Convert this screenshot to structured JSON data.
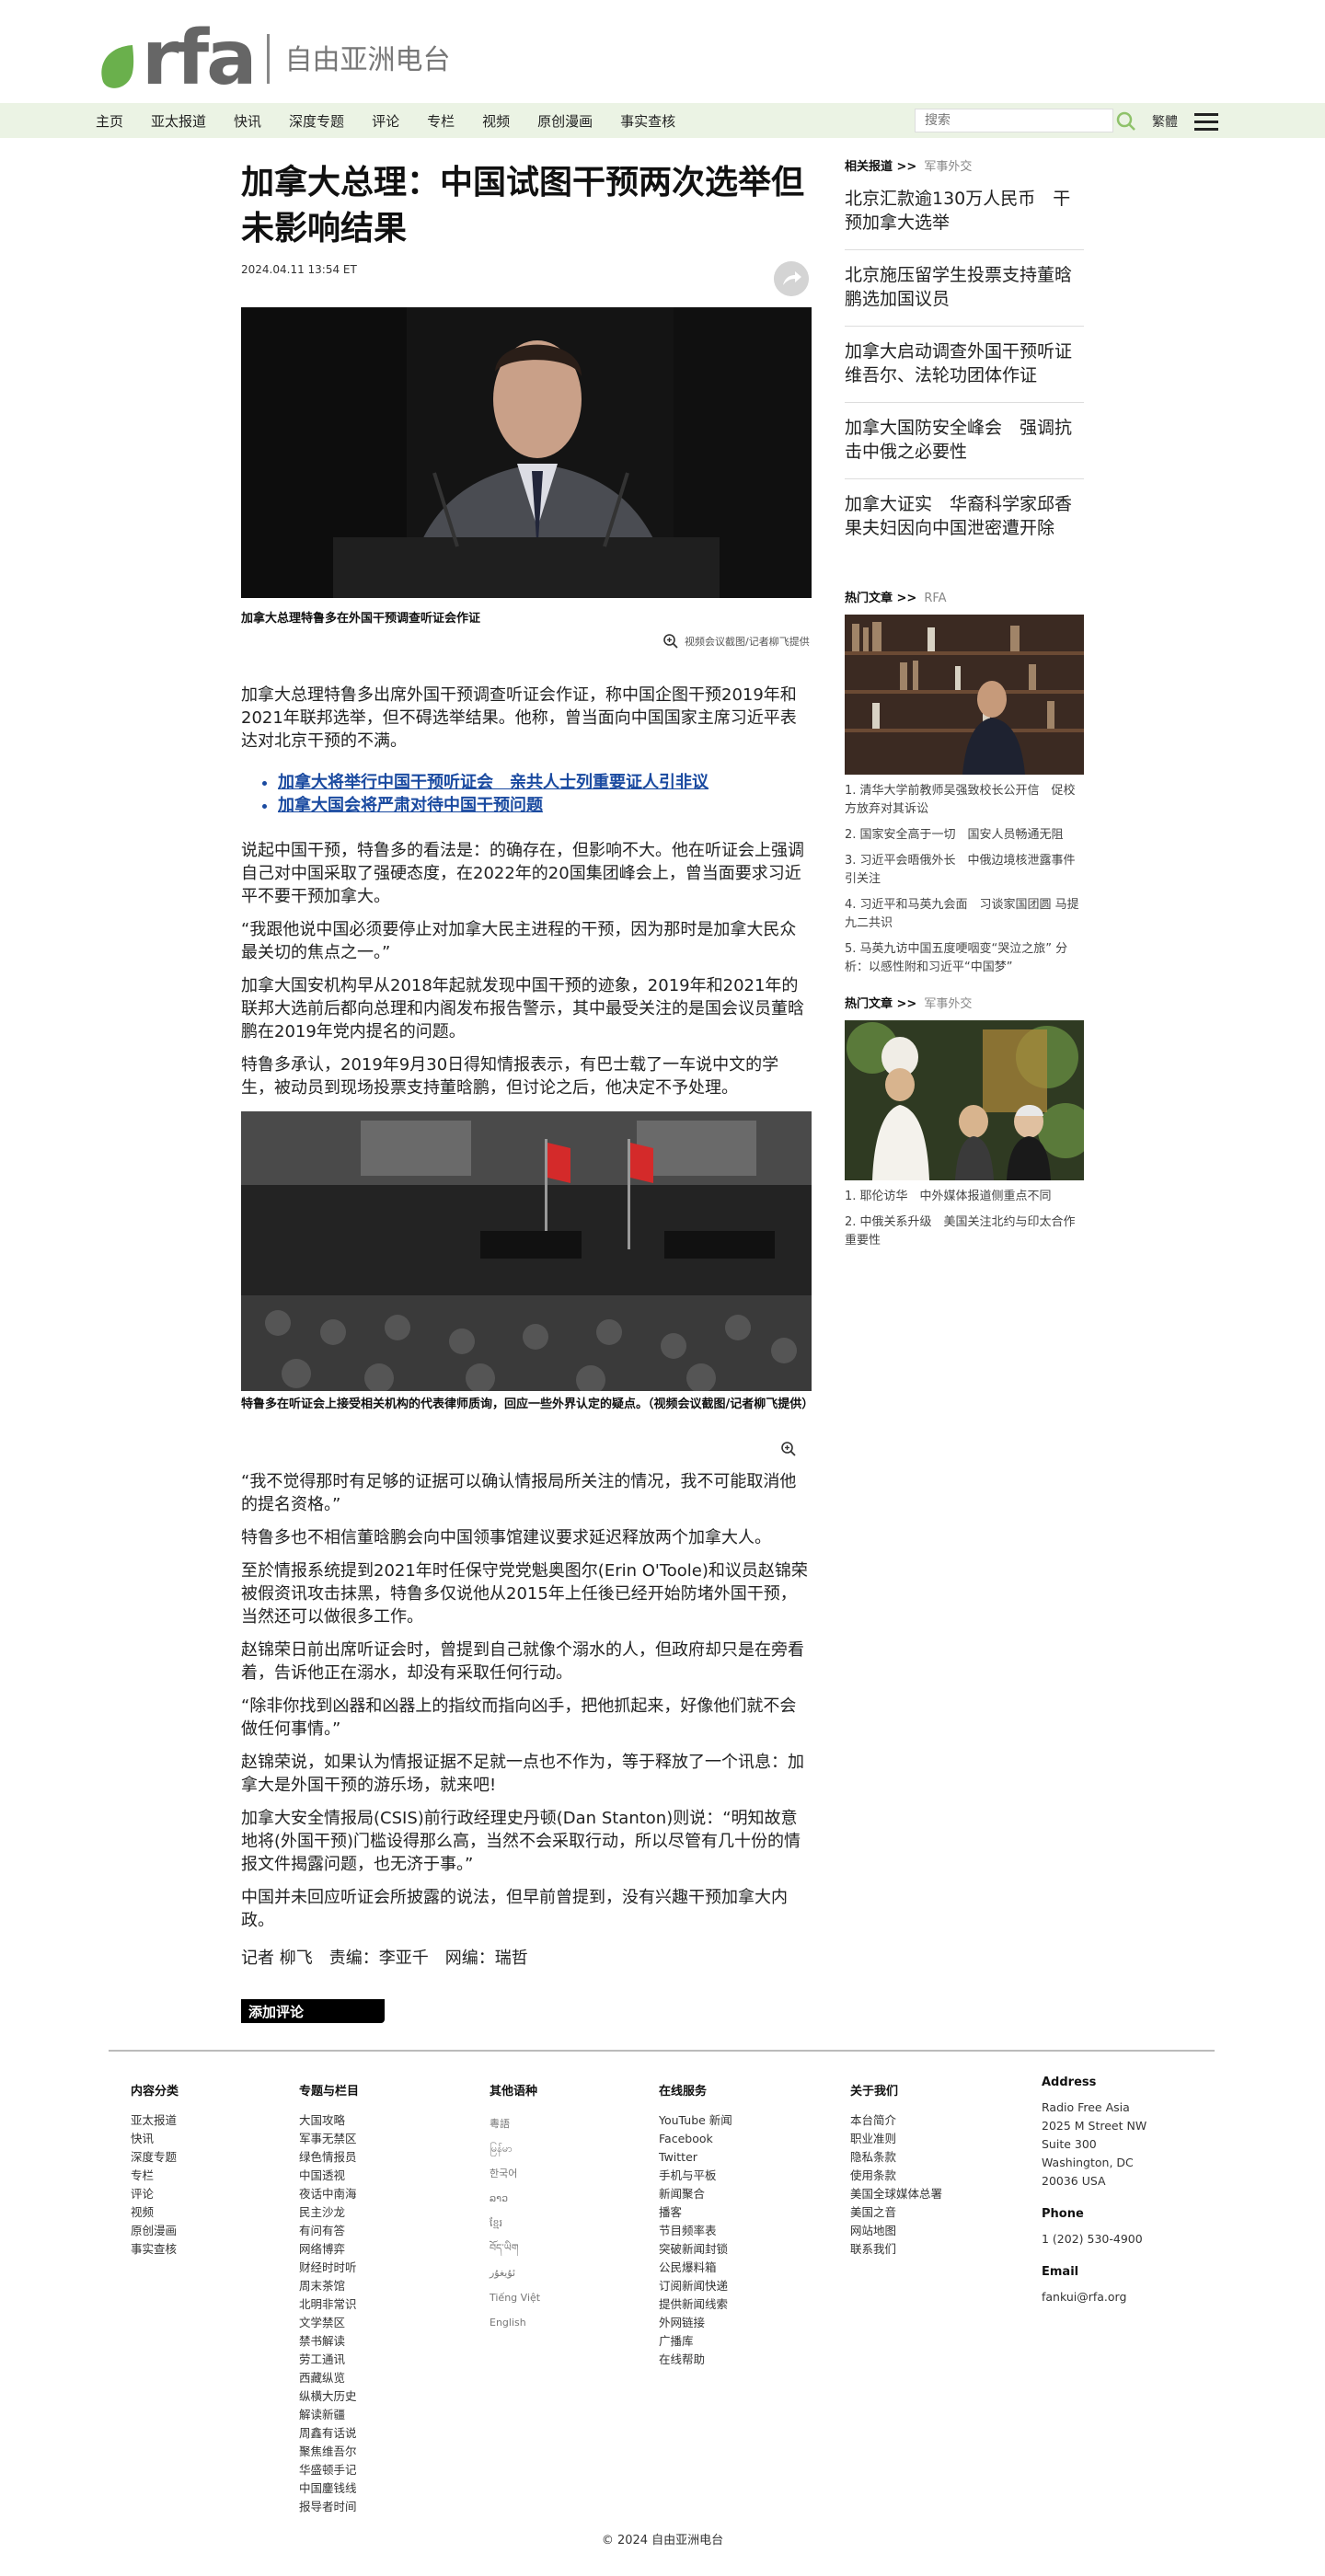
{
  "header": {
    "logo_text": "rfa",
    "logo_cn": "自由亚洲电台",
    "nav": [
      "主页",
      "亚太报道",
      "快讯",
      "深度专题",
      "评论",
      "专栏",
      "视频",
      "原创漫画",
      "事实查核"
    ],
    "search_placeholder": "搜索",
    "lang_toggle": "繁體"
  },
  "article": {
    "title": "加拿大总理：中国试图干预两次选举但未影响结果",
    "timestamp": "2024.04.11 13:54 ET",
    "fig1_caption": "加拿大总理特鲁多在外国干预调查听证会作证",
    "fig1_credit": "视频会议截图/记者柳飞提供",
    "lead": "加拿大总理特鲁多出席外国干预调查听证会作证，称中国企图干预2019年和2021年联邦选举，但不碍选举结果。他称，曾当面向中国国家主席习近平表达对北京干预的不满。",
    "related_links": [
      "加拿大将举行中国干预听证会　亲共人士列重要证人引非议",
      "加拿大国会将严肃对待中国干预问题"
    ],
    "body2": [
      "说起中国干预，特鲁多的看法是：的确存在，但影响不大。他在听证会上强调自己对中国采取了强硬态度，在2022年的20国集团峰会上，曾当面要求习近平不要干预加拿大。",
      "“我跟他说中国必须要停止对加拿大民主进程的干预，因为那时是加拿大民众最关切的焦点之一。”",
      "加拿大国安机构早从2018年起就发现中国干预的迹象，2019年和2021年的联邦大选前后都向总理和内阁发布报告警示，其中最受关注的是国会议员董晗鹏在2019年党内提名的问题。",
      "特鲁多承认，2019年9月30日得知情报表示，有巴士载了一车说中文的学生，被动员到现场投票支持董晗鹏，但讨论之后，他决定不予处理。"
    ],
    "fig2_caption": "特鲁多在听证会上接受相关机构的代表律师质询，回应一些外界认定的疑点。（视频会议截图/记者柳飞提供）",
    "body3": [
      "“我不觉得那时有足够的证据可以确认情报局所关注的情况，我不可能取消他的提名资格。”",
      "特鲁多也不相信董晗鹏会向中国领事馆建议要求延迟释放两个加拿大人。",
      "至於情报系统提到2021年时任保守党党魁奥图尔(Erin O'Toole)和议员赵锦荣被假资讯攻击抹黑，特鲁多仅说他从2015年上任後已经开始防堵外国干预，当然还可以做很多工作。",
      "赵锦荣日前出席听证会时，曾提到自己就像个溺水的人，但政府却只是在旁看着，告诉他正在溺水，却没有采取任何行动。",
      "“除非你找到凶器和凶器上的指纹而指向凶手，把他抓起来，好像他们就不会做任何事情。”",
      "赵锦荣说，如果认为情报证据不足就一点也不作为，等于释放了一个讯息：加拿大是外国干预的游乐场，就来吧!",
      "加拿大安全情报局(CSIS)前行政经理史丹顿(Dan Stanton)则说：“明知故意地将(外国干预)门槛设得那么高，当然不会采取行动，所以尽管有几十份的情报文件揭露问题，也无济于事。”",
      "中国并未回应听证会所披露的说法，但早前曾提到，没有兴趣干预加拿大内政。"
    ],
    "byline": "记者 柳飞　责编：李亚千　网编：瑞哲",
    "comment_button": "添加评论"
  },
  "sidebar": {
    "related_head": "相关报道 >>",
    "related_sub": "军事外交",
    "related_stories": [
      "北京汇款逾130万人民币　干预加拿大选举",
      "北京施压留学生投票支持董晗鹏选加国议员",
      "加拿大启动调查外国干预听证维吾尔、法轮功团体作证",
      "加拿大国防安全峰会　强调抗击中俄之必要性",
      "加拿大证实　华裔科学家邱香果夫妇因向中国泄密遭开除"
    ],
    "hot1_head": "热门文章 >>",
    "hot1_sub": "RFA",
    "hot1_items": [
      "1. 清华大学前教师吴强致校长公开信　促校方放弃对其诉讼",
      "2. 国家安全高于一切　国安人员畅通无阻",
      "3. 习近平会晤俄外长　中俄边境核泄露事件引关注",
      "4. 习近平和马英九会面　习谈家国团圆 马提九二共识",
      "5. 马英九访中国五度哽咽变“哭泣之旅” 分析：以感性附和习近平“中国梦”"
    ],
    "hot2_head": "热门文章 >>",
    "hot2_sub": "军事外交",
    "hot2_items": [
      "1. 耶伦访华　中外媒体报道侧重点不同",
      "2. 中俄关系升级　美国关注北约与印太合作重要性"
    ]
  },
  "footer": {
    "col1_title": "内容分类",
    "col1": [
      "亚太报道",
      "快讯",
      "深度专题",
      "专栏",
      "评论",
      "视频",
      "原创漫画",
      "事实查核"
    ],
    "col2_title": "专题与栏目",
    "col2": [
      "大国攻略",
      "军事无禁区",
      "绿色情报员",
      "中国透视",
      "夜话中南海",
      "民主沙龙",
      "有问有答",
      "网络博弈",
      "财经时时听",
      "周末茶馆",
      "北明非常识",
      "文学禁区",
      "禁书解读",
      "劳工通讯",
      "西藏纵览",
      "纵横大历史",
      "解读新疆",
      "周鑫有话说",
      "聚焦维吾尔",
      "华盛顿手记",
      "中国鏖钱线",
      "报导者时间"
    ],
    "col3_title": "其他语种",
    "col3": [
      "粵語",
      "မြန်မာ",
      "한국어",
      "ລາວ",
      "ខ្មែរ",
      "བོད་ཡིག",
      "ئۇيغۇر",
      "Tiếng Việt",
      "English"
    ],
    "col4_title": "在线服务",
    "col4": [
      "YouTube 新闻",
      "Facebook",
      "Twitter",
      "手机与平板",
      "新闻聚合",
      "播客",
      "节目频率表",
      "突破新闻封锁",
      "公民爆料箱",
      "订阅新闻快递",
      "提供新闻线索",
      "外网链接",
      "广播库",
      "在线帮助"
    ],
    "col5_title": "关于我们",
    "col5": [
      "本台简介",
      "职业准则",
      "隐私条款",
      "使用条款",
      "美国全球媒体总署",
      "美国之音",
      "网站地图",
      "联系我们"
    ],
    "address_title": "Address",
    "address": [
      "Radio Free Asia",
      "2025 M Street NW",
      "Suite 300",
      "Washington, DC",
      "20036 USA"
    ],
    "phone_title": "Phone",
    "phone": "1 (202) 530-4900",
    "email_title": "Email",
    "email": "fankui@rfa.org",
    "copyright": "© 2024 自由亚洲电台"
  }
}
